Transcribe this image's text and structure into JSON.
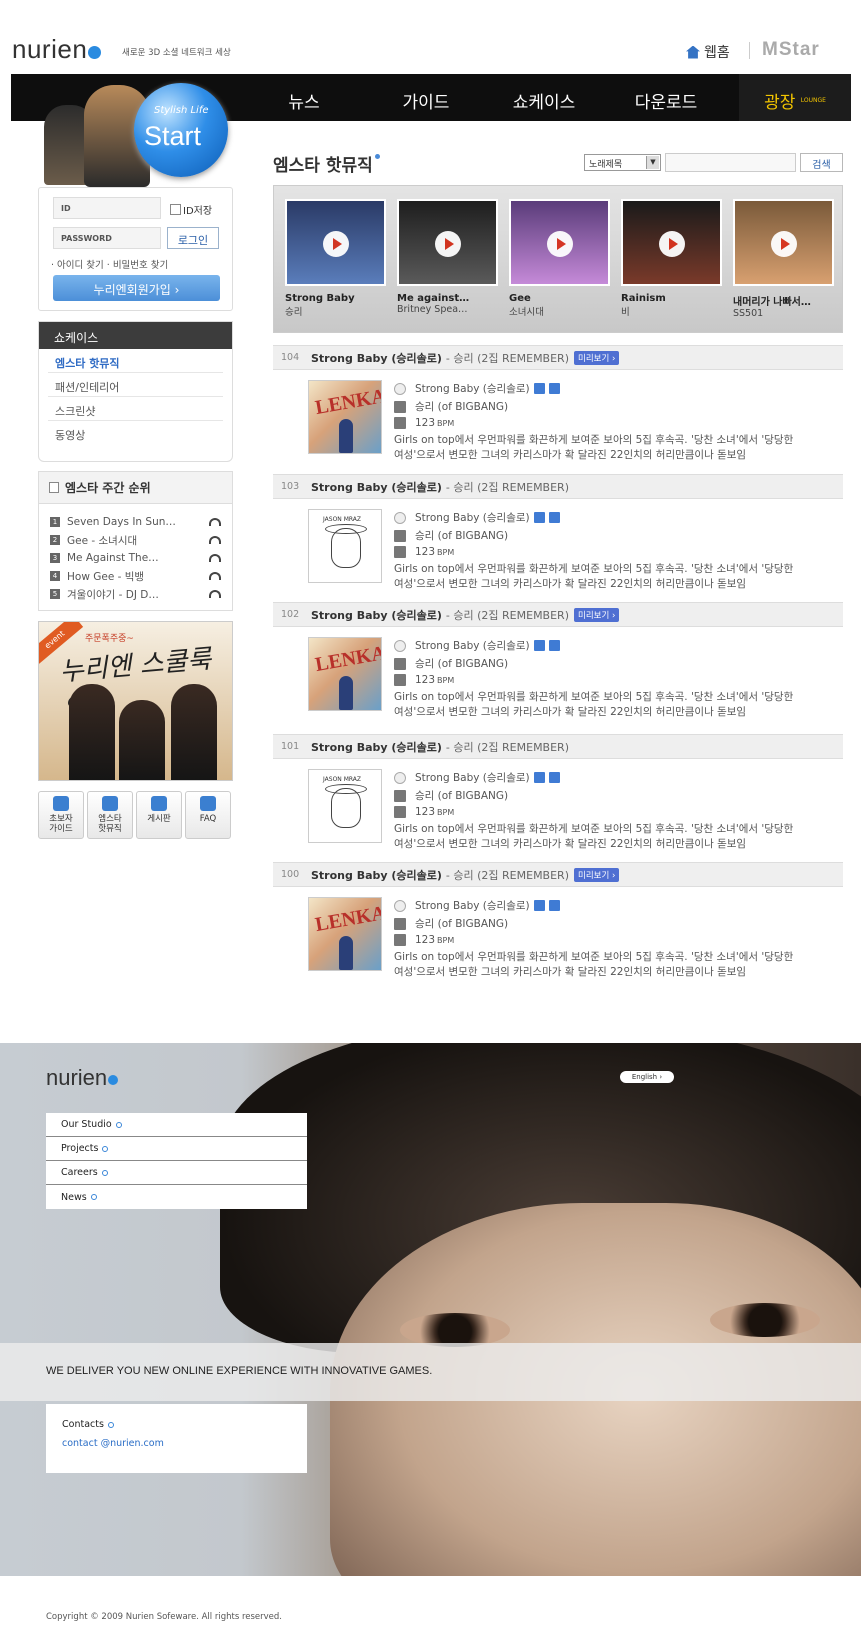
{
  "header": {
    "logo": "nurien",
    "tagline": "새로운 3D 소셜 네트워크 세상",
    "home_label": "웹홈",
    "mstar_logo": "MStar"
  },
  "nav": {
    "items": [
      "뉴스",
      "가이드",
      "쇼케이스",
      "다운로드"
    ],
    "lounge": "광장",
    "lounge_sub": "LOUNGE"
  },
  "start_banner": {
    "line1": "Stylish Life",
    "line2": "Start"
  },
  "login": {
    "id_placeholder": "ID",
    "pw_placeholder": "PASSWORD",
    "save_id": "ID저장",
    "login_button": "로그인",
    "find": "· 아이디 찾기 · 비밀번호 찾기",
    "join_button": "누리엔회원가입 ›"
  },
  "showcase": {
    "title": "쇼케이스",
    "items": [
      "엠스타 핫뮤직",
      "패션/인테리어",
      "스크린샷",
      "동영상"
    ]
  },
  "ranking": {
    "title": "엠스타 주간 순위",
    "items": [
      {
        "num": "1",
        "title": "Seven Days In Sun…"
      },
      {
        "num": "2",
        "title": "Gee - 소녀시대"
      },
      {
        "num": "3",
        "title": "Me Against The…"
      },
      {
        "num": "4",
        "title": "How Gee - 빅뱅"
      },
      {
        "num": "5",
        "title": "겨울이야기 - DJ D…"
      }
    ]
  },
  "event": {
    "tag": "event",
    "sub": "주문폭주중~",
    "title": "누리엔 스쿨룩 입고"
  },
  "quick_links": [
    {
      "line1": "초보자",
      "line2": "가이드"
    },
    {
      "line1": "엠스타",
      "line2": "핫뮤직"
    },
    {
      "line1": "게시판",
      "line2": ""
    },
    {
      "line1": "FAQ",
      "line2": ""
    }
  ],
  "main": {
    "title": "엠스타 핫뮤직",
    "select_value": "노래제목",
    "search_button": "검색",
    "cards": [
      {
        "title": "Strong Baby",
        "artist": "승리"
      },
      {
        "title": "Me against…",
        "artist": "Britney Spea…"
      },
      {
        "title": "Gee",
        "artist": "소녀시대"
      },
      {
        "title": "Rainism",
        "artist": "비"
      },
      {
        "title": "내머리가 나빠서…",
        "artist": "SS501"
      }
    ],
    "preview_label": "미리보기 ›",
    "entries": [
      {
        "num": "104",
        "title": "Strong Baby (승리솔로)",
        "sub": "- 승리 (2집 REMEMBER)",
        "song": "Strong Baby (승리솔로)",
        "artist": "승리 (of BIGBANG)",
        "bpm": "123",
        "bpm_unit": "BPM",
        "desc1": "Girls on top에서 우먼파워를 화끈하게 보여준 보아의 5집 후속곡. '당찬 소녀'에서 '당당한",
        "desc2": "여성'으로서 변모한 그녀의 카리스마가 확 달라진 22인치의 허리만큼이나 돋보임"
      },
      {
        "num": "103",
        "title": "Strong Baby (승리솔로)",
        "sub": "- 승리 (2집 REMEMBER)",
        "song": "Strong Baby (승리솔로)",
        "artist": "승리 (of BIGBANG)",
        "bpm": "123",
        "bpm_unit": "BPM",
        "desc1": "Girls on top에서 우먼파워를 화끈하게 보여준 보아의 5집 후속곡. '당찬 소녀'에서 '당당한",
        "desc2": "여성'으로서 변모한 그녀의 카리스마가 확 달라진 22인치의 허리만큼이나 돋보임"
      },
      {
        "num": "102",
        "title": "Strong Baby (승리솔로)",
        "sub": "- 승리 (2집 REMEMBER)",
        "song": "Strong Baby (승리솔로)",
        "artist": "승리 (of BIGBANG)",
        "bpm": "123",
        "bpm_unit": "BPM",
        "desc1": "Girls on top에서 우먼파워를 화끈하게 보여준 보아의 5집 후속곡. '당찬 소녀'에서 '당당한",
        "desc2": "여성'으로서 변모한 그녀의 카리스마가 확 달라진 22인치의 허리만큼이나 돋보임"
      },
      {
        "num": "101",
        "title": "Strong Baby (승리솔로)",
        "sub": "- 승리 (2집 REMEMBER)",
        "song": "Strong Baby (승리솔로)",
        "artist": "승리 (of BIGBANG)",
        "bpm": "123",
        "bpm_unit": "BPM",
        "desc1": "Girls on top에서 우먼파워를 화끈하게 보여준 보아의 5집 후속곡. '당찬 소녀'에서 '당당한",
        "desc2": "여성'으로서 변모한 그녀의 카리스마가 확 달라진 22인치의 허리만큼이나 돋보임"
      },
      {
        "num": "100",
        "title": "Strong Baby (승리솔로)",
        "sub": "- 승리 (2집 REMEMBER)",
        "song": "Strong Baby (승리솔로)",
        "artist": "승리 (of BIGBANG)",
        "bpm": "123",
        "bpm_unit": "BPM",
        "desc1": "Girls on top에서 우먼파워를 화끈하게 보여준 보아의 5집 후속곡. '당찬 소녀'에서 '당당한",
        "desc2": "여성'으로서 변모한 그녀의 카리스마가 확 달라진 22인치의 허리만큼이나 돋보임"
      }
    ]
  },
  "corp": {
    "logo": "nurien",
    "lang_button": "English ›",
    "menu": [
      "Our Studio",
      "Projects",
      "Careers",
      "News"
    ],
    "slogan": "WE DELIVER YOU NEW ONLINE EXPERIENCE WITH INNOVATIVE GAMES.",
    "contacts_title": "Contacts",
    "contacts_email": "contact @nurien.com",
    "copyright": "Copyright © 2009 Nurien Sofeware. All rights reserved."
  },
  "colors": {
    "nav_bg": "#0e0e0e",
    "lounge": "#f2c400",
    "accent_blue": "#2f6bc4",
    "preview_badge": "#4f6fd2"
  }
}
